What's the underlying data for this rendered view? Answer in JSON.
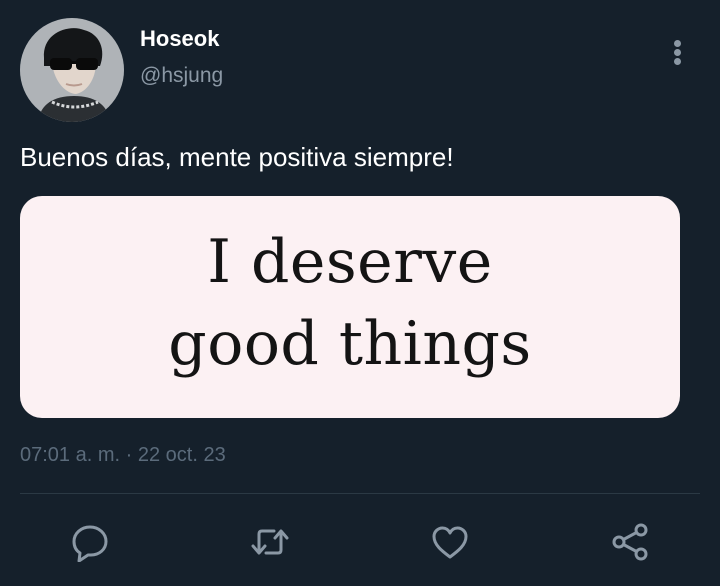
{
  "user": {
    "display_name": "Hoseok",
    "handle": "@hsjung",
    "avatar_icon": "profile-photo"
  },
  "tweet": {
    "text": "Buenos días, mente positiva siempre!",
    "media": {
      "line1": "I deserve",
      "line2": "good things"
    },
    "time": "07:01 a. m.",
    "separator": "·",
    "date": "22 oct. 23"
  },
  "actions": [
    {
      "icon": "reply-icon"
    },
    {
      "icon": "retweet-icon"
    },
    {
      "icon": "like-icon"
    },
    {
      "icon": "share-icon"
    }
  ],
  "colors": {
    "background": "#15202b",
    "primary_text": "#ffffff",
    "secondary_text": "#8b98a5",
    "icon": "#8b98a5",
    "media_background": "#fcf1f3"
  }
}
